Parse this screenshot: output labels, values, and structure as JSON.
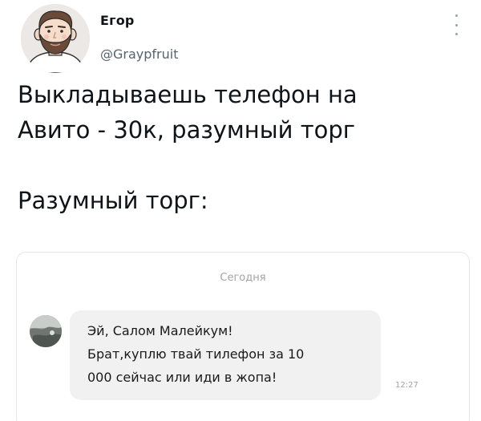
{
  "author": {
    "name": "Егор",
    "handle": "@Graypfruit"
  },
  "tweet": {
    "text": "Выкладываешь телефон на\nАвито - 30к, разумный торг\n\nРазумный торг:"
  },
  "chat": {
    "date_label": "Сегодня",
    "message_lines": [
      "Эй, Салом Малейкум!",
      "Брат,куплю твай тилефон за 10",
      "000 сейчас или иди в жопа!"
    ],
    "time": "12:27"
  },
  "icons": {
    "more": "more-vertical-icon",
    "avatar": "user-avatar",
    "chat_avatar": "sender-avatar"
  },
  "colors": {
    "text": "#0f1419",
    "handle": "#536471",
    "bubble": "#f1f1f1",
    "muted": "#a3a3a3"
  }
}
